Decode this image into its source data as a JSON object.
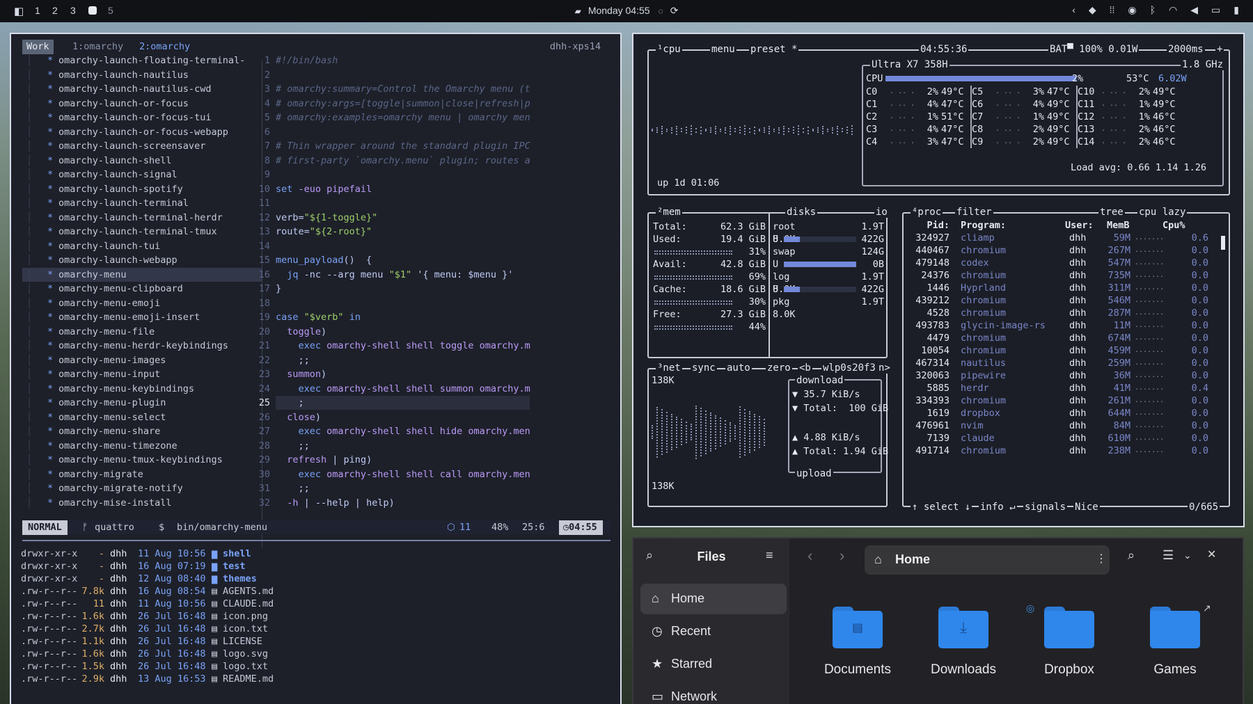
{
  "topbar": {
    "workspaces": [
      "1",
      "2",
      "3",
      "5"
    ],
    "clock": "Monday 04:55"
  },
  "term": {
    "session": "Work",
    "win1": "1:omarchy",
    "win2": "2:omarchy",
    "host": "dhh-xps14",
    "tree": [
      "omarchy-launch-floating-terminal-",
      "omarchy-launch-nautilus",
      "omarchy-launch-nautilus-cwd",
      "omarchy-launch-or-focus",
      "omarchy-launch-or-focus-tui",
      "omarchy-launch-or-focus-webapp",
      "omarchy-launch-screensaver",
      "omarchy-launch-shell",
      "omarchy-launch-signal",
      "omarchy-launch-spotify",
      "omarchy-launch-terminal",
      "omarchy-launch-terminal-herdr",
      "omarchy-launch-terminal-tmux",
      "omarchy-launch-tui",
      "omarchy-launch-webapp",
      "omarchy-menu",
      "omarchy-menu-clipboard",
      "omarchy-menu-emoji",
      "omarchy-menu-emoji-insert",
      "omarchy-menu-file",
      "omarchy-menu-herdr-keybindings",
      "omarchy-menu-images",
      "omarchy-menu-input",
      "omarchy-menu-keybindings",
      "omarchy-menu-plugin",
      "omarchy-menu-select",
      "omarchy-menu-share",
      "omarchy-menu-timezone",
      "omarchy-menu-tmux-keybindings",
      "omarchy-migrate",
      "omarchy-migrate-notify",
      "omarchy-mise-install"
    ],
    "selected_index": 15,
    "code": [
      "#!/bin/bash",
      "",
      "# omarchy:summary=Control the Omarchy menu (togg",
      "# omarchy:args=[toggle|summon|close|refresh|ping",
      "# omarchy:examples=omarchy menu | omarchy menu t",
      "",
      "# Thin wrapper around the standard plugin IPC su",
      "# first-party `omarchy.menu` plugin; routes are",
      "",
      "set -euo pipefail",
      "",
      "verb=\"${1-toggle}\"",
      "route=\"${2-root}\"",
      "",
      "menu_payload() {",
      "  jq -nc --arg menu \"$1\" '{ menu: $menu }'",
      "}",
      "",
      "case \"$verb\" in",
      "  toggle)",
      "    exec omarchy-shell shell toggle omarchy.menu",
      "    ;;",
      "  summon)",
      "    exec omarchy-shell shell summon omarchy.menu",
      "    ;",
      "  close)",
      "    exec omarchy-shell shell hide omarchy.menu",
      "    ;;",
      "  refresh | ping)",
      "    exec omarchy-shell shell call omarchy.menu \"",
      "    ;;",
      "  -h | --help | help)"
    ],
    "status": {
      "mode": "NORMAL",
      "branch": "quattro",
      "prompt": "$",
      "file": "bin/omarchy-menu",
      "diag": "11",
      "pct": "48%",
      "pos": "25:6",
      "time": "04:55"
    },
    "ls": [
      {
        "perm": "drwxr-xr-x",
        "size": "-",
        "user": "dhh",
        "date": "11 Aug 10:56",
        "name": "shell",
        "dir": true
      },
      {
        "perm": "drwxr-xr-x",
        "size": "-",
        "user": "dhh",
        "date": "16 Aug 07:19",
        "name": "test",
        "dir": true
      },
      {
        "perm": "drwxr-xr-x",
        "size": "-",
        "user": "dhh",
        "date": "12 Aug 08:40",
        "name": "themes",
        "dir": true
      },
      {
        "perm": ".rw-r--r--",
        "size": "7.8k",
        "user": "dhh",
        "date": "16 Aug 08:54",
        "name": "AGENTS.md",
        "dir": false
      },
      {
        "perm": ".rw-r--r--",
        "size": "11",
        "user": "dhh",
        "date": "11 Aug 10:56",
        "name": "CLAUDE.md",
        "dir": false
      },
      {
        "perm": ".rw-r--r--",
        "size": "1.6k",
        "user": "dhh",
        "date": "26 Jul 16:48",
        "name": "icon.png",
        "dir": false
      },
      {
        "perm": ".rw-r--r--",
        "size": "2.7k",
        "user": "dhh",
        "date": "26 Jul 16:48",
        "name": "icon.txt",
        "dir": false
      },
      {
        "perm": ".rw-r--r--",
        "size": "1.1k",
        "user": "dhh",
        "date": "26 Jul 16:48",
        "name": "LICENSE",
        "dir": false
      },
      {
        "perm": ".rw-r--r--",
        "size": "1.6k",
        "user": "dhh",
        "date": "26 Jul 16:48",
        "name": "logo.svg",
        "dir": false
      },
      {
        "perm": ".rw-r--r--",
        "size": "1.5k",
        "user": "dhh",
        "date": "26 Jul 16:48",
        "name": "logo.txt",
        "dir": false
      },
      {
        "perm": ".rw-r--r--",
        "size": "2.9k",
        "user": "dhh",
        "date": "13 Aug 16:53",
        "name": "README.md",
        "dir": false
      }
    ]
  },
  "btop": {
    "cpu_tabs": [
      "¹cpu",
      "menu",
      "preset *"
    ],
    "time": "04:55:36",
    "battery": "BAT▀ 100% 0.01W",
    "interval": "2000ms",
    "model": "Ultra X7 358H",
    "freq": "1.8 GHz",
    "cpu_total": {
      "label": "CPU",
      "pct": "2%",
      "temp": "53°C",
      "power": "6.02W",
      "frac": 0.02
    },
    "cores": [
      [
        "C0",
        "2%",
        "49°C",
        "C5",
        "3%",
        "47°C",
        "C10",
        "2%",
        "49°C"
      ],
      [
        "C1",
        "4%",
        "47°C",
        "C6",
        "4%",
        "49°C",
        "C11",
        "1%",
        "49°C"
      ],
      [
        "C2",
        "1%",
        "51°C",
        "C7",
        "1%",
        "49°C",
        "C12",
        "1%",
        "46°C"
      ],
      [
        "C3",
        "4%",
        "47°C",
        "C8",
        "2%",
        "49°C",
        "C13",
        "2%",
        "46°C"
      ],
      [
        "C4",
        "3%",
        "47°C",
        "C9",
        "2%",
        "49°C",
        "C14",
        "2%",
        "46°C"
      ]
    ],
    "loadavg": "Load avg: 0.66 1.14 1.26",
    "uptime": "up 1d 01:06",
    "mem": {
      "title": "²mem",
      "rows": [
        {
          "label": "Total:",
          "value": "62.3 GiB",
          "pct": ""
        },
        {
          "label": "Used:",
          "value": "19.4 GiB",
          "pct": "31%"
        },
        {
          "label": "Avail:",
          "value": "42.8 GiB",
          "pct": "69%"
        },
        {
          "label": "Cache:",
          "value": "18.6 GiB",
          "pct": "30%"
        },
        {
          "label": "Free:",
          "value": "27.3 GiB",
          "pct": "44%"
        }
      ]
    },
    "disks": {
      "title": "disks",
      "io": "io",
      "items": [
        {
          "name": "root",
          "size": "1.9T",
          "used": "8.0K",
          "u": "422G",
          "frac": 0.99
        },
        {
          "name": "swap",
          "size": "124G",
          "used": "",
          "u": "0B",
          "frac": 1.0
        },
        {
          "name": "log",
          "size": "1.9T",
          "used": "8.0K",
          "u": "422G",
          "frac": 0.2
        },
        {
          "name": "pkg",
          "size": "1.9T",
          "used": "8.0K",
          "u": "",
          "frac": 0
        }
      ]
    },
    "net": {
      "tabs": [
        "³net",
        "sync",
        "auto",
        "zero"
      ],
      "iface": "wlp0s20f3",
      "top": "138K",
      "bottom": "138K",
      "download": "download",
      "dl_rate": "▼ 35.7 KiB/s",
      "dl_total": "▼ Total:  100 GiB",
      "ul_rate": "▲ 4.88 KiB/s",
      "ul_total": "▲ Total: 1.94 GiB",
      "upload": "upload"
    },
    "proc": {
      "tabs": [
        "⁴proc",
        "filter"
      ],
      "tree": "tree",
      "sort": "cpu lazy",
      "headers": [
        "Pid:",
        "Program:",
        "User:",
        "MemB",
        "Cpu%"
      ],
      "rows": [
        [
          "324927",
          "cliamp",
          "dhh",
          "59M",
          "0.6"
        ],
        [
          "440467",
          "chromium",
          "dhh",
          "267M",
          "0.0"
        ],
        [
          "479148",
          "codex",
          "dhh",
          "547M",
          "0.0"
        ],
        [
          "24376",
          "chromium",
          "dhh",
          "735M",
          "0.0"
        ],
        [
          "1446",
          "Hyprland",
          "dhh",
          "311M",
          "0.0"
        ],
        [
          "439212",
          "chromium",
          "dhh",
          "546M",
          "0.0"
        ],
        [
          "4528",
          "chromium",
          "dhh",
          "287M",
          "0.0"
        ],
        [
          "493783",
          "glycin-image-rs",
          "dhh",
          "11M",
          "0.0"
        ],
        [
          "4479",
          "chromium",
          "dhh",
          "674M",
          "0.0"
        ],
        [
          "10054",
          "chromium",
          "dhh",
          "459M",
          "0.0"
        ],
        [
          "467314",
          "nautilus",
          "dhh",
          "259M",
          "0.0"
        ],
        [
          "320063",
          "pipewire",
          "dhh",
          "36M",
          "0.0"
        ],
        [
          "5885",
          "herdr",
          "dhh",
          "41M",
          "0.4"
        ],
        [
          "334393",
          "chromium",
          "dhh",
          "261M",
          "0.0"
        ],
        [
          "1619",
          "dropbox",
          "dhh",
          "644M",
          "0.0"
        ],
        [
          "476961",
          "nvim",
          "dhh",
          "84M",
          "0.0"
        ],
        [
          "7139",
          "claude",
          "dhh",
          "610M",
          "0.0"
        ],
        [
          "491714",
          "chromium",
          "dhh",
          "238M",
          "0.0"
        ]
      ],
      "footer": [
        "↑ select ↓",
        "info ↵",
        "signals",
        "Nice"
      ],
      "count": "0/665"
    }
  },
  "files": {
    "app_title": "Files",
    "location": "Home",
    "sidebar": [
      "Home",
      "Recent",
      "Starred",
      "Network"
    ],
    "folders": [
      "Documents",
      "Downloads",
      "Dropbox",
      "Games"
    ]
  }
}
